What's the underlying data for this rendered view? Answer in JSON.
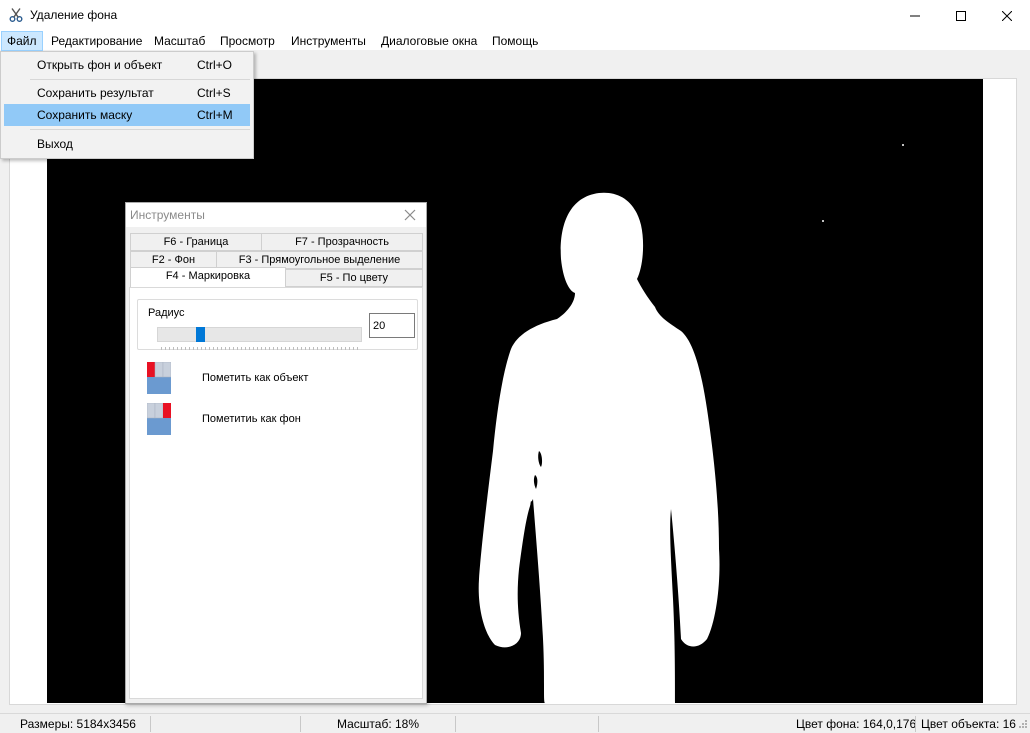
{
  "window": {
    "title": "Удаление фона",
    "icon": "scissors-icon",
    "controls": [
      "minimize-icon",
      "maximize-icon",
      "close-icon"
    ]
  },
  "menubar": {
    "items": [
      "Файл",
      "Редактирование",
      "Масштаб",
      "Просмотр",
      "Инструменты",
      "Диалоговые окна",
      "Помощь"
    ],
    "active": "Файл"
  },
  "file_menu": {
    "items": [
      {
        "label": "Открыть фон и объект",
        "shortcut": "Ctrl+O"
      },
      {
        "label": "Сохранить результат",
        "shortcut": "Ctrl+S"
      },
      {
        "label": "Сохранить маску",
        "shortcut": "Ctrl+M",
        "highlighted": true
      },
      {
        "label": "Выход",
        "shortcut": ""
      }
    ]
  },
  "tools": {
    "title": "Инструменты",
    "tabs": {
      "row1": [
        "F6 - Граница",
        "F7 - Прозрачность"
      ],
      "row2": [
        "F2 - Фон",
        "F3 - Прямоугольное выделение"
      ],
      "row3": [
        "F4 - Маркировка",
        "F5 - По цвету"
      ],
      "selected": "F4 - Маркировка"
    },
    "radius": {
      "label": "Радиус",
      "value": "20",
      "slider_fraction": 0.2
    },
    "mark_object": "Пометить как объект",
    "mark_background": "Пометитиь как фон",
    "colors": {
      "marker": "#e81123",
      "tile": "#c8d0dc",
      "base": "#6b9ad0"
    }
  },
  "statusbar": {
    "size": "Размеры: 5184x3456",
    "zoom": "Масштаб: 18%",
    "bg_color": "Цвет фона: 164,0,176",
    "obj_color": "Цвет объекта: 16"
  }
}
